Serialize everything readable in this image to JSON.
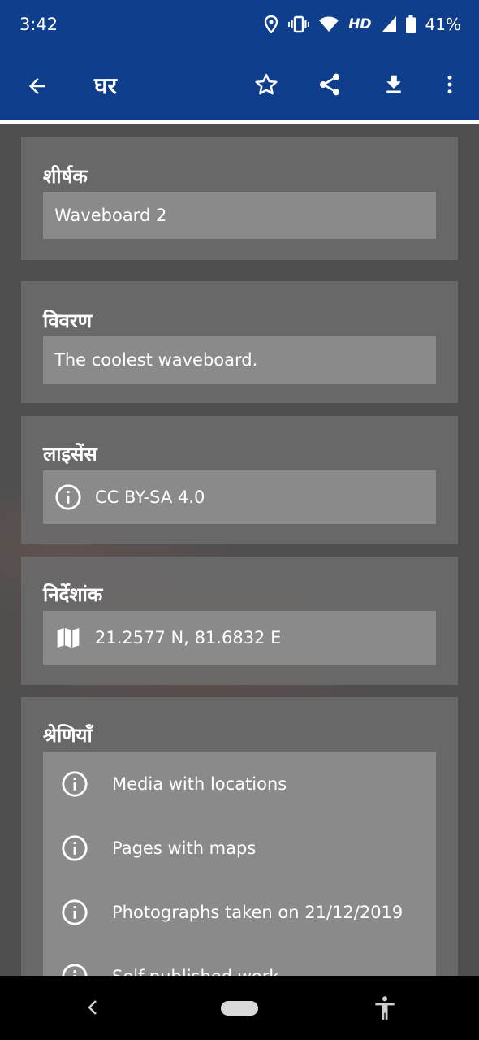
{
  "status": {
    "time": "3:42",
    "hd": "HD",
    "battery": "41%",
    "icons": [
      "location-icon",
      "vibrate-icon",
      "wifi-icon",
      "signal-icon",
      "battery-icon"
    ]
  },
  "app_bar": {
    "title": "घर",
    "icons": [
      "back-arrow-icon",
      "star-icon",
      "share-icon",
      "download-icon",
      "more-vert-icon"
    ]
  },
  "cards": {
    "title": {
      "heading": "शीर्षक",
      "value": "Waveboard 2"
    },
    "description": {
      "heading": "विवरण",
      "value": "The coolest waveboard."
    },
    "license": {
      "heading": "लाइसेंस",
      "value": "CC BY-SA 4.0",
      "icon": "info-icon"
    },
    "coordinates": {
      "heading": "निर्देशांक",
      "value": "21.2577 N, 81.6832 E",
      "icon": "map-icon"
    },
    "categories": {
      "heading": "श्रेणियाँ",
      "items": [
        "Media with locations",
        "Pages with maps",
        "Photographs taken on 21/12/2019",
        "Self-published work"
      ]
    }
  },
  "nav": {
    "icons": [
      "nav-back-icon",
      "nav-home-pill",
      "accessibility-icon"
    ]
  },
  "colors": {
    "brand": "#0f3f8c",
    "background": "#4f4f4f",
    "card": "#6e6e6e",
    "field": "#969696"
  }
}
